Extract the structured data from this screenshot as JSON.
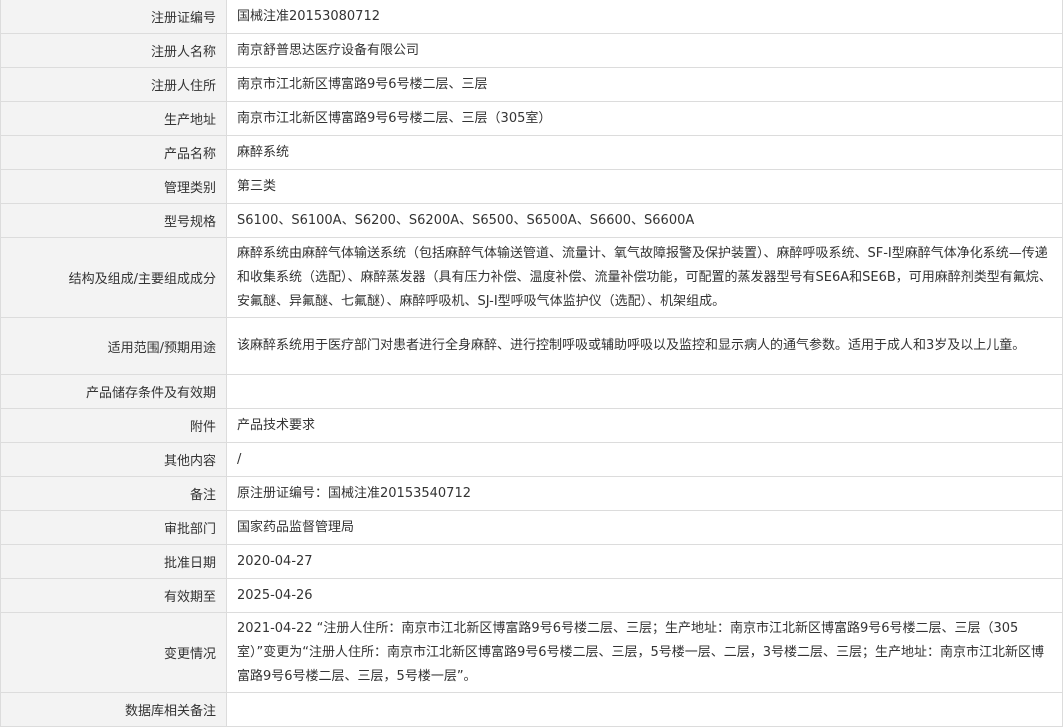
{
  "rows": [
    {
      "label": "注册证编号",
      "value": "国械注准20153080712"
    },
    {
      "label": "注册人名称",
      "value": "南京舒普思达医疗设备有限公司"
    },
    {
      "label": "注册人住所",
      "value": "南京市江北新区博富路9号6号楼二层、三层"
    },
    {
      "label": "生产地址",
      "value": "南京市江北新区博富路9号6号楼二层、三层（305室）"
    },
    {
      "label": "产品名称",
      "value": "麻醉系统"
    },
    {
      "label": "管理类别",
      "value": "第三类"
    },
    {
      "label": "型号规格",
      "value": "S6100、S6100A、S6200、S6200A、S6500、S6500A、S6600、S6600A"
    },
    {
      "label": "结构及组成/主要组成成分",
      "value": "麻醉系统由麻醉气体输送系统（包括麻醉气体输送管道、流量计、氧气故障报警及保护装置）、麻醉呼吸系统、SF-I型麻醉气体净化系统—传递和收集系统（选配）、麻醉蒸发器（具有压力补偿、温度补偿、流量补偿功能，可配置的蒸发器型号有SE6A和SE6B，可用麻醉剂类型有氟烷、安氟醚、异氟醚、七氟醚）、麻醉呼吸机、SJ-I型呼吸气体监护仪（选配）、机架组成。"
    },
    {
      "label": "适用范围/预期用途",
      "value": "该麻醉系统用于医疗部门对患者进行全身麻醉、进行控制呼吸或辅助呼吸以及监控和显示病人的通气参数。适用于成人和3岁及以上儿童。"
    },
    {
      "label": "产品储存条件及有效期",
      "value": ""
    },
    {
      "label": "附件",
      "value": "产品技术要求"
    },
    {
      "label": "其他内容",
      "value": "/"
    },
    {
      "label": "备注",
      "value": "原注册证编号：国械注准20153540712"
    },
    {
      "label": "审批部门",
      "value": "国家药品监督管理局"
    },
    {
      "label": "批准日期",
      "value": "2020-04-27"
    },
    {
      "label": "有效期至",
      "value": "2025-04-26"
    },
    {
      "label": "变更情况",
      "value": "2021-04-22 “注册人住所：南京市江北新区博富路9号6号楼二层、三层；生产地址：南京市江北新区博富路9号6号楼二层、三层（305室）”变更为“注册人住所：南京市江北新区博富路9号6号楼二层、三层，5号楼一层、二层，3号楼二层、三层；生产地址：南京市江北新区博富路9号6号楼二层、三层，5号楼一层”。"
    },
    {
      "label": "数据库相关备注",
      "value": ""
    }
  ]
}
